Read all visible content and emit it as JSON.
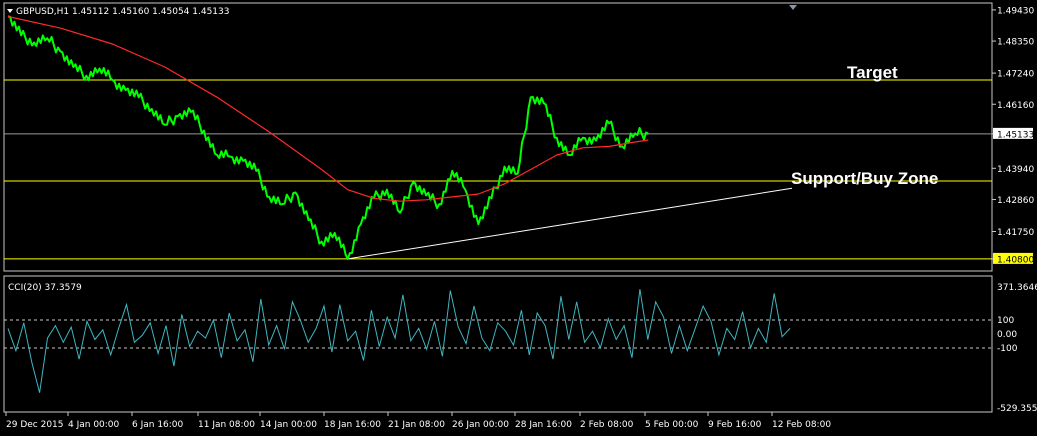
{
  "header": {
    "title": "GBPUSD,H1  1.45112 1.45160 1.45054 1.45133",
    "indicator": "CCI(20) 37.3579"
  },
  "colors": {
    "background": "#000000",
    "price": "#00ff00",
    "ma": "#ff2a2a",
    "level": "#ffff00",
    "trendline": "#ffffff",
    "cci": "#3fb6c0",
    "grid": "#c8c8c8"
  },
  "chart_data": [
    {
      "type": "line",
      "panel": "price",
      "x": [
        "29 Dec 2015",
        "4 Jan 00:00",
        "6 Jan 16:00",
        "11 Jan 08:00",
        "14 Jan 00:00",
        "18 Jan 16:00",
        "21 Jan 08:00",
        "26 Jan 00:00",
        "28 Jan 16:00",
        "2 Feb 08:00",
        "5 Feb 00:00",
        "9 Feb 16:00",
        "12 Feb 08:00"
      ],
      "ylim": [
        1.4045,
        1.496
      ],
      "yticks": [
        "1.49430",
        "1.48350",
        "1.47240",
        "1.46160",
        "1.45133",
        "1.43940",
        "1.42860",
        "1.41750",
        "1.40800"
      ],
      "series": [
        {
          "name": "",
          "values": [
            [
              0,
              1.492
            ],
            [
              1,
              1.4855
            ],
            [
              2,
              1.483
            ],
            [
              3,
              1.4845
            ],
            [
              4,
              1.48
            ],
            [
              5,
              1.4745
            ],
            [
              6,
              1.4715
            ],
            [
              7,
              1.474
            ],
            [
              8,
              1.47
            ],
            [
              9,
              1.4665
            ],
            [
              10,
              1.464
            ],
            [
              11,
              1.46
            ],
            [
              12,
              1.4545
            ],
            [
              13,
              1.4575
            ],
            [
              14,
              1.459
            ],
            [
              15,
              1.4525
            ],
            [
              16,
              1.444
            ],
            [
              17,
              1.4435
            ],
            [
              18,
              1.442
            ],
            [
              19,
              1.4385
            ],
            [
              20,
              1.4295
            ],
            [
              21,
              1.427
            ],
            [
              22,
              1.431
            ],
            [
              23,
              1.4215
            ],
            [
              24,
              1.414
            ],
            [
              25,
              1.417
            ],
            [
              26,
              1.408
            ],
            [
              27,
              1.42
            ],
            [
              28,
              1.429
            ],
            [
              29,
              1.432
            ],
            [
              30,
              1.424
            ],
            [
              31,
              1.4345
            ],
            [
              32,
              1.43
            ],
            [
              33,
              1.427
            ],
            [
              34,
              1.4385
            ],
            [
              35,
              1.432
            ],
            [
              36,
              1.42
            ],
            [
              37,
              1.429
            ],
            [
              38,
              1.44
            ],
            [
              39,
              1.4375
            ],
            [
              40,
              1.464
            ],
            [
              41,
              1.462
            ],
            [
              42,
              1.45
            ],
            [
              43,
              1.444
            ],
            [
              44,
              1.45
            ],
            [
              45,
              1.449
            ],
            [
              46,
              1.455
            ],
            [
              47,
              1.447
            ],
            [
              48,
              1.4515
            ],
            [
              49,
              1.4513
            ]
          ]
        },
        {
          "name": "",
          "values": [
            [
              0,
              1.492
            ],
            [
              4,
              1.488
            ],
            [
              8,
              1.4825
            ],
            [
              12,
              1.4745
            ],
            [
              16,
              1.464
            ],
            [
              20,
              1.452
            ],
            [
              24,
              1.439
            ],
            [
              26,
              1.432
            ],
            [
              28,
              1.429
            ],
            [
              30,
              1.428
            ],
            [
              32,
              1.4285
            ],
            [
              34,
              1.4295
            ],
            [
              36,
              1.4305
            ],
            [
              38,
              1.434
            ],
            [
              40,
              1.439
            ],
            [
              42,
              1.444
            ],
            [
              44,
              1.4465
            ],
            [
              46,
              1.447
            ],
            [
              48,
              1.4485
            ],
            [
              49,
              1.4492
            ]
          ]
        }
      ],
      "levels": [
        {
          "value": 1.47,
          "label": "1.47000"
        },
        {
          "value": 1.435,
          "label": "1.43500"
        },
        {
          "value": 1.408,
          "label": "1.40800"
        }
      ],
      "current_price": {
        "value": 1.45133,
        "label": "1.45133"
      },
      "trendline": {
        "from": [
          26,
          1.408
        ],
        "to": [
          60,
          1.4325
        ]
      },
      "annotations": [
        "Target",
        "Support/Buy Zone"
      ]
    },
    {
      "type": "line",
      "panel": "indicator",
      "name": "CCI(20)",
      "ylim": [
        -529.3557,
        371.3646
      ],
      "yticks": [
        "371.3646",
        "100",
        "0.00",
        "-100",
        "-529.3557"
      ],
      "levels": [
        100,
        -100
      ],
      "values": [
        40,
        -120,
        80,
        -200,
        -420,
        -30,
        60,
        -60,
        50,
        -180,
        90,
        -40,
        30,
        -150,
        40,
        210,
        -60,
        -10,
        80,
        -140,
        60,
        -230,
        140,
        -90,
        20,
        -30,
        100,
        -170,
        150,
        -50,
        30,
        -200,
        250,
        -80,
        60,
        -110,
        230,
        100,
        -60,
        40,
        200,
        -130,
        210,
        -50,
        20,
        -190,
        170,
        -90,
        120,
        -30,
        280,
        -50,
        40,
        -110,
        90,
        -160,
        310,
        50,
        -70,
        200,
        -30,
        -120,
        80,
        20,
        -80,
        170,
        -150,
        150,
        60,
        -180,
        270,
        -40,
        230,
        -60,
        20,
        -100,
        110,
        -40,
        60,
        -170,
        320,
        -40,
        230,
        120,
        -140,
        60,
        -120,
        40,
        200,
        90,
        -150,
        40,
        -40,
        160,
        -100,
        40,
        -60,
        290,
        -20,
        40
      ]
    }
  ],
  "time_axis": [
    "29 Dec 2015",
    "4 Jan 00:00",
    "6 Jan 16:00",
    "11 Jan 08:00",
    "14 Jan 00:00",
    "18 Jan 16:00",
    "21 Jan 08:00",
    "26 Jan 00:00",
    "28 Jan 16:00",
    "2 Feb 08:00",
    "5 Feb 00:00",
    "9 Feb 16:00",
    "12 Feb 08:00"
  ]
}
